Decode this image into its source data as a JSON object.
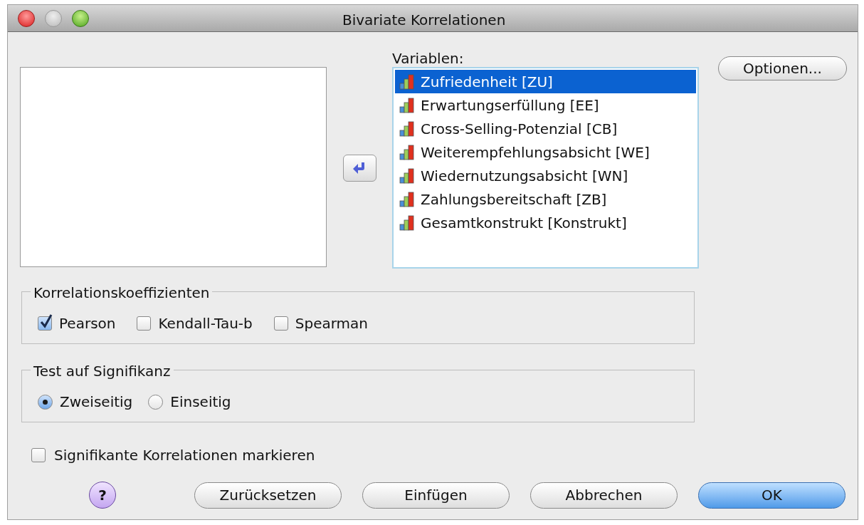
{
  "window": {
    "title": "Bivariate Korrelationen"
  },
  "variables": {
    "label": "Variablen:",
    "items": [
      {
        "name": "Zufriedenheit [ZU]",
        "selected": true
      },
      {
        "name": "Erwartungserfüllung [EE]",
        "selected": false
      },
      {
        "name": "Cross-Selling-Potenzial [CB]",
        "selected": false
      },
      {
        "name": "Weiterempfehlungsabsicht [WE]",
        "selected": false
      },
      {
        "name": "Wiedernutzungsabsicht [WN]",
        "selected": false
      },
      {
        "name": "Zahlungsbereitschaft [ZB]",
        "selected": false
      },
      {
        "name": "Gesamtkonstrukt [Konstrukt]",
        "selected": false
      }
    ]
  },
  "options_button": "Optionen...",
  "coefficients": {
    "title": "Korrelationskoeffizienten",
    "items": [
      {
        "label": "Pearson",
        "checked": true
      },
      {
        "label": "Kendall-Tau-b",
        "checked": false
      },
      {
        "label": "Spearman",
        "checked": false
      }
    ]
  },
  "significance": {
    "title": "Test auf Signifikanz",
    "items": [
      {
        "label": "Zweiseitig",
        "selected": true
      },
      {
        "label": "Einseitig",
        "selected": false
      }
    ]
  },
  "flag_significant": {
    "label": "Signifikante Korrelationen markieren",
    "checked": false
  },
  "help_button": "?",
  "buttons": [
    {
      "label": "Zurücksetzen",
      "default": false
    },
    {
      "label": "Einfügen",
      "default": false
    },
    {
      "label": "Abbrechen",
      "default": false
    },
    {
      "label": "OK",
      "default": true
    }
  ]
}
